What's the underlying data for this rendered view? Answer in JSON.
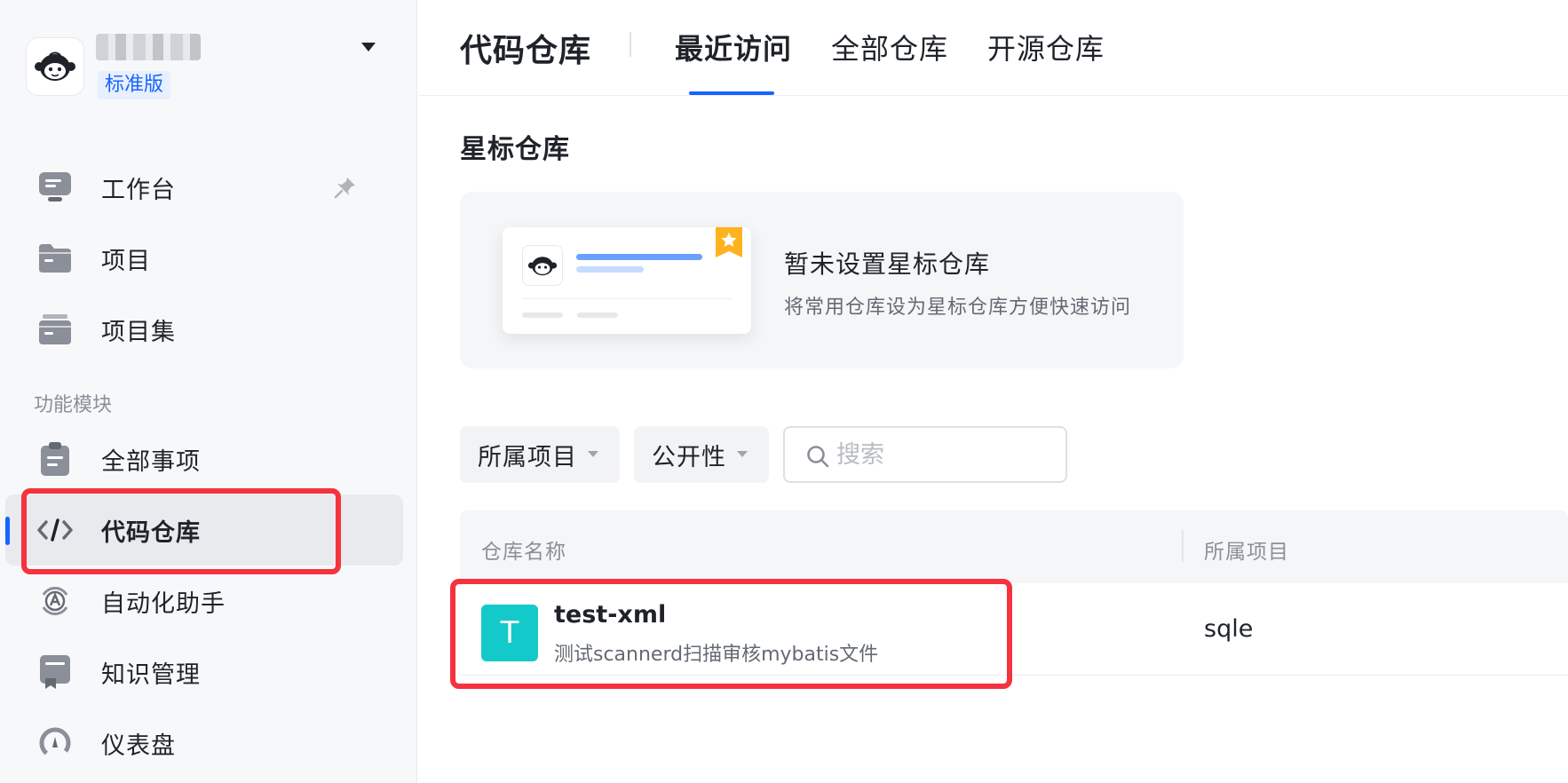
{
  "workspace": {
    "plan": "标准版"
  },
  "sidebar": {
    "items": [
      {
        "label": "工作台",
        "icon": "desk-icon"
      },
      {
        "label": "项目",
        "icon": "folder-icon"
      },
      {
        "label": "项目集",
        "icon": "folders-icon"
      }
    ],
    "section_title": "功能模块",
    "module_items": [
      {
        "label": "全部事项",
        "icon": "clipboard-icon"
      },
      {
        "label": "代码仓库",
        "icon": "code-icon",
        "active": true
      },
      {
        "label": "自动化助手",
        "icon": "automation-icon"
      },
      {
        "label": "知识管理",
        "icon": "book-icon"
      },
      {
        "label": "仪表盘",
        "icon": "gauge-icon"
      }
    ]
  },
  "header": {
    "title": "代码仓库",
    "tabs": [
      "最近访问",
      "全部仓库",
      "开源仓库"
    ],
    "active_tab": "最近访问"
  },
  "starred": {
    "heading": "星标仓库",
    "empty_title": "暂未设置星标仓库",
    "empty_desc": "将常用仓库设为星标仓库方便快速访问"
  },
  "filters": {
    "project_label": "所属项目",
    "visibility_label": "公开性",
    "search_placeholder": "搜索"
  },
  "table": {
    "columns": [
      "仓库名称",
      "所属项目"
    ],
    "rows": [
      {
        "avatar": "T",
        "name": "test-xml",
        "desc": "测试scannerd扫描审核mybatis文件",
        "project": "sqle"
      }
    ]
  },
  "colors": {
    "accent": "#1664ff",
    "highlight": "#f5333f",
    "avatar_bg": "#14c9c9"
  }
}
